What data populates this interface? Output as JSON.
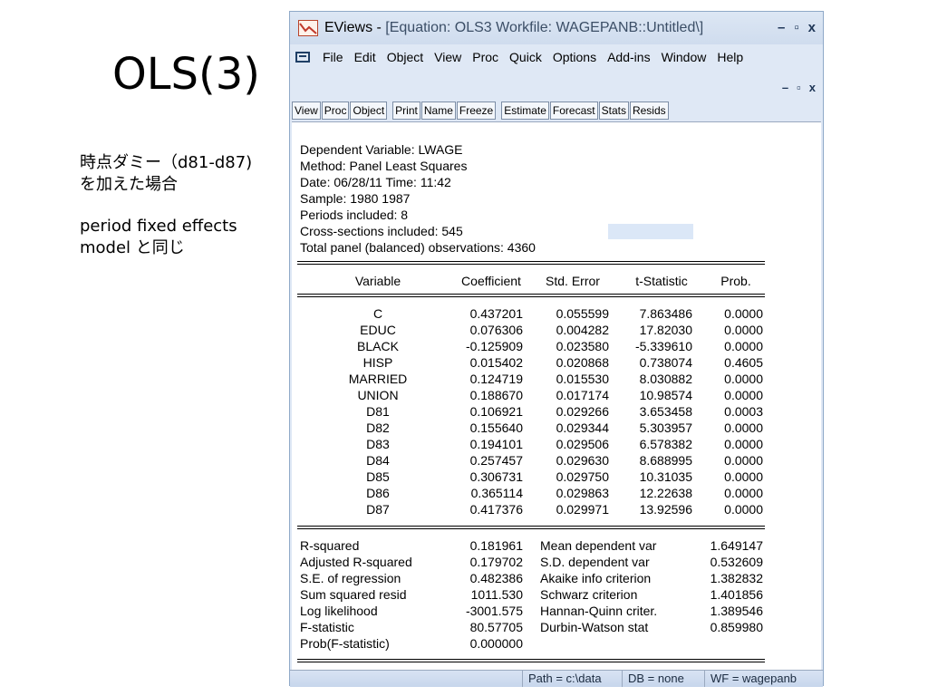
{
  "slide": {
    "title": "OLS(3)",
    "notes": [
      "時点ダミー（d81-d87)を加えた場合",
      "period fixed effects model と同じ"
    ]
  },
  "window": {
    "app": "EViews - ",
    "subtitle": "[Equation: OLS3   Workfile: WAGEPANB::Untitled\\]",
    "controls": [
      "–",
      "▫",
      "x"
    ],
    "mdi_controls": [
      "–",
      "▫",
      "x"
    ]
  },
  "menu": [
    "File",
    "Edit",
    "Object",
    "View",
    "Proc",
    "Quick",
    "Options",
    "Add-ins",
    "Window",
    "Help"
  ],
  "toolbar": {
    "group1": [
      "View",
      "Proc",
      "Object"
    ],
    "group2": [
      "Print",
      "Name",
      "Freeze"
    ],
    "group3": [
      "Estimate",
      "Forecast",
      "Stats",
      "Resids"
    ]
  },
  "header": [
    "Dependent Variable: LWAGE",
    "Method: Panel Least Squares",
    "Date: 06/28/11   Time: 11:42",
    "Sample: 1980 1987",
    "Periods included: 8",
    "Cross-sections included: 545",
    "Total panel (balanced) observations: 4360"
  ],
  "coef_table": {
    "columns": [
      "Variable",
      "Coefficient",
      "Std. Error",
      "t-Statistic",
      "Prob."
    ],
    "rows": [
      [
        "C",
        "0.437201",
        "0.055599",
        "7.863486",
        "0.0000"
      ],
      [
        "EDUC",
        "0.076306",
        "0.004282",
        "17.82030",
        "0.0000"
      ],
      [
        "BLACK",
        "-0.125909",
        "0.023580",
        "-5.339610",
        "0.0000"
      ],
      [
        "HISP",
        "0.015402",
        "0.020868",
        "0.738074",
        "0.4605"
      ],
      [
        "MARRIED",
        "0.124719",
        "0.015530",
        "8.030882",
        "0.0000"
      ],
      [
        "UNION",
        "0.188670",
        "0.017174",
        "10.98574",
        "0.0000"
      ],
      [
        "D81",
        "0.106921",
        "0.029266",
        "3.653458",
        "0.0003"
      ],
      [
        "D82",
        "0.155640",
        "0.029344",
        "5.303957",
        "0.0000"
      ],
      [
        "D83",
        "0.194101",
        "0.029506",
        "6.578382",
        "0.0000"
      ],
      [
        "D84",
        "0.257457",
        "0.029630",
        "8.688995",
        "0.0000"
      ],
      [
        "D85",
        "0.306731",
        "0.029750",
        "10.31035",
        "0.0000"
      ],
      [
        "D86",
        "0.365114",
        "0.029863",
        "12.22638",
        "0.0000"
      ],
      [
        "D87",
        "0.417376",
        "0.029971",
        "13.92596",
        "0.0000"
      ]
    ]
  },
  "stats": {
    "left": [
      [
        "R-squared",
        "0.181961"
      ],
      [
        "Adjusted R-squared",
        "0.179702"
      ],
      [
        "S.E. of regression",
        "0.482386"
      ],
      [
        "Sum squared resid",
        "1011.530"
      ],
      [
        "Log likelihood",
        "-3001.575"
      ],
      [
        "F-statistic",
        "80.57705"
      ],
      [
        "Prob(F-statistic)",
        "0.000000"
      ]
    ],
    "right": [
      [
        "Mean dependent var",
        "1.649147"
      ],
      [
        "S.D. dependent var",
        "0.532609"
      ],
      [
        "Akaike info criterion",
        "1.382832"
      ],
      [
        "Schwarz criterion",
        "1.401856"
      ],
      [
        "Hannan-Quinn criter.",
        "1.389546"
      ],
      [
        "Durbin-Watson stat",
        "0.859980"
      ]
    ]
  },
  "status": {
    "path": "Path = c:\\data",
    "db": "DB = none",
    "wf": "WF = wagepanb"
  },
  "colors": {
    "window_bg": "#dfe8f5",
    "titlebar": "#cfdcee",
    "selection": "#dbe7f7"
  }
}
